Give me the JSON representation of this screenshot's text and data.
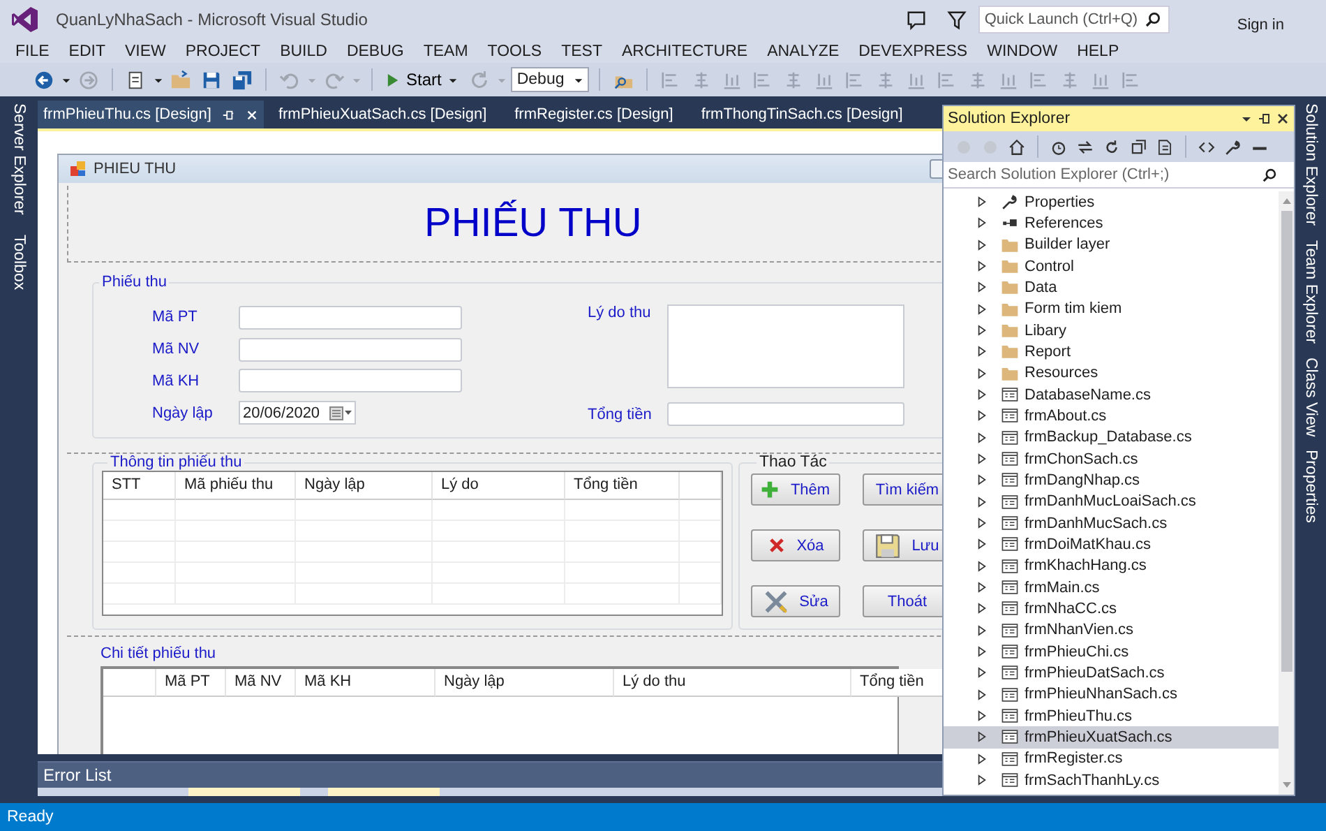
{
  "window": {
    "title": "QuanLyNhaSach - Microsoft Visual Studio"
  },
  "quick_launch": {
    "placeholder": "Quick Launch (Ctrl+Q)"
  },
  "sign_in": "Sign in",
  "menu": [
    "FILE",
    "EDIT",
    "VIEW",
    "PROJECT",
    "BUILD",
    "DEBUG",
    "TEAM",
    "TOOLS",
    "TEST",
    "ARCHITECTURE",
    "ANALYZE",
    "DEVEXPRESS",
    "WINDOW",
    "HELP"
  ],
  "toolbar": {
    "start": "Start",
    "configuration": "Debug"
  },
  "left_tabs": [
    "Server Explorer",
    "Toolbox"
  ],
  "doc_tabs": [
    {
      "label": "frmPhieuThu.cs [Design]",
      "selected": true
    },
    {
      "label": "frmPhieuXuatSach.cs [Design]",
      "selected": false
    },
    {
      "label": "frmRegister.cs [Design]",
      "selected": false
    },
    {
      "label": "frmThongTinSach.cs [Design]",
      "selected": false
    }
  ],
  "form": {
    "title": "PHIEU THU",
    "heading": "PHIẾU THU",
    "info_group": {
      "title": "Phiếu thu",
      "fields": [
        {
          "label": "Mã PT",
          "kind": "text"
        },
        {
          "label": "Mã NV",
          "kind": "text"
        },
        {
          "label": "Mã KH",
          "kind": "text"
        },
        {
          "label": "Ngày lập",
          "kind": "date",
          "value": "20/06/2020"
        }
      ],
      "reason": {
        "label": "Lý do thu"
      },
      "total": {
        "label": "Tổng tiền"
      }
    },
    "list_group": {
      "title": "Thông tin phiếu thu",
      "columns": [
        "STT",
        "Mã phiếu thu",
        "Ngày lập",
        "Lý do",
        "Tổng tiền"
      ]
    },
    "actions": {
      "title": "Thao Tác",
      "buttons": [
        {
          "label": "Thêm",
          "kind": "add"
        },
        {
          "label": "Tìm kiếm",
          "kind": "plain"
        },
        {
          "label": "Xóa",
          "kind": "delete"
        },
        {
          "label": "Lưu",
          "kind": "save"
        },
        {
          "label": "Sửa",
          "kind": "edit"
        },
        {
          "label": "Thoát",
          "kind": "plain"
        }
      ]
    },
    "detail_group": {
      "title": "Chi tiết phiếu thu",
      "columns": [
        "Mã PT",
        "Mã NV",
        "Mã KH",
        "Ngày lập",
        "Lý do thu",
        "Tổng tiền"
      ]
    }
  },
  "error_list": {
    "title": "Error List"
  },
  "solution_explorer": {
    "title": "Solution Explorer",
    "search": {
      "placeholder": "Search Solution Explorer (Ctrl+;)"
    },
    "items": [
      {
        "label": "Properties",
        "kind": "properties",
        "expanded": false,
        "selected": false
      },
      {
        "label": "References",
        "kind": "references",
        "expanded": false,
        "selected": false
      },
      {
        "label": "Builder layer",
        "kind": "folder",
        "expanded": false,
        "selected": false
      },
      {
        "label": "Control",
        "kind": "folder",
        "expanded": false,
        "selected": false
      },
      {
        "label": "Data",
        "kind": "folder",
        "expanded": false,
        "selected": false
      },
      {
        "label": "Form tim kiem",
        "kind": "folder",
        "expanded": false,
        "selected": false
      },
      {
        "label": "Libary",
        "kind": "folder",
        "expanded": false,
        "selected": false
      },
      {
        "label": "Report",
        "kind": "folder",
        "expanded": false,
        "selected": false
      },
      {
        "label": "Resources",
        "kind": "folder",
        "expanded": false,
        "selected": false
      },
      {
        "label": "DatabaseName.cs",
        "kind": "form",
        "expanded": false,
        "selected": false
      },
      {
        "label": "frmAbout.cs",
        "kind": "form",
        "expanded": false,
        "selected": false
      },
      {
        "label": "frmBackup_Database.cs",
        "kind": "form",
        "expanded": false,
        "selected": false
      },
      {
        "label": "frmChonSach.cs",
        "kind": "form",
        "expanded": false,
        "selected": false
      },
      {
        "label": "frmDangNhap.cs",
        "kind": "form",
        "expanded": false,
        "selected": false
      },
      {
        "label": "frmDanhMucLoaiSach.cs",
        "kind": "form",
        "expanded": false,
        "selected": false
      },
      {
        "label": "frmDanhMucSach.cs",
        "kind": "form",
        "expanded": false,
        "selected": false
      },
      {
        "label": "frmDoiMatKhau.cs",
        "kind": "form",
        "expanded": false,
        "selected": false
      },
      {
        "label": "frmKhachHang.cs",
        "kind": "form",
        "expanded": false,
        "selected": false
      },
      {
        "label": "frmMain.cs",
        "kind": "form",
        "expanded": false,
        "selected": false
      },
      {
        "label": "frmNhaCC.cs",
        "kind": "form",
        "expanded": false,
        "selected": false
      },
      {
        "label": "frmNhanVien.cs",
        "kind": "form",
        "expanded": false,
        "selected": false
      },
      {
        "label": "frmPhieuChi.cs",
        "kind": "form",
        "expanded": false,
        "selected": false
      },
      {
        "label": "frmPhieuDatSach.cs",
        "kind": "form",
        "expanded": false,
        "selected": false
      },
      {
        "label": "frmPhieuNhanSach.cs",
        "kind": "form",
        "expanded": false,
        "selected": false
      },
      {
        "label": "frmPhieuThu.cs",
        "kind": "form",
        "expanded": false,
        "selected": false
      },
      {
        "label": "frmPhieuXuatSach.cs",
        "kind": "form",
        "expanded": false,
        "selected": true
      },
      {
        "label": "frmRegister.cs",
        "kind": "form",
        "expanded": false,
        "selected": false
      },
      {
        "label": "frmSachThanhLy.cs",
        "kind": "form",
        "expanded": false,
        "selected": false
      }
    ]
  },
  "right_tabs": [
    "Solution Explorer",
    "Team Explorer",
    "Class View",
    "Properties"
  ],
  "status_bar": "Ready"
}
